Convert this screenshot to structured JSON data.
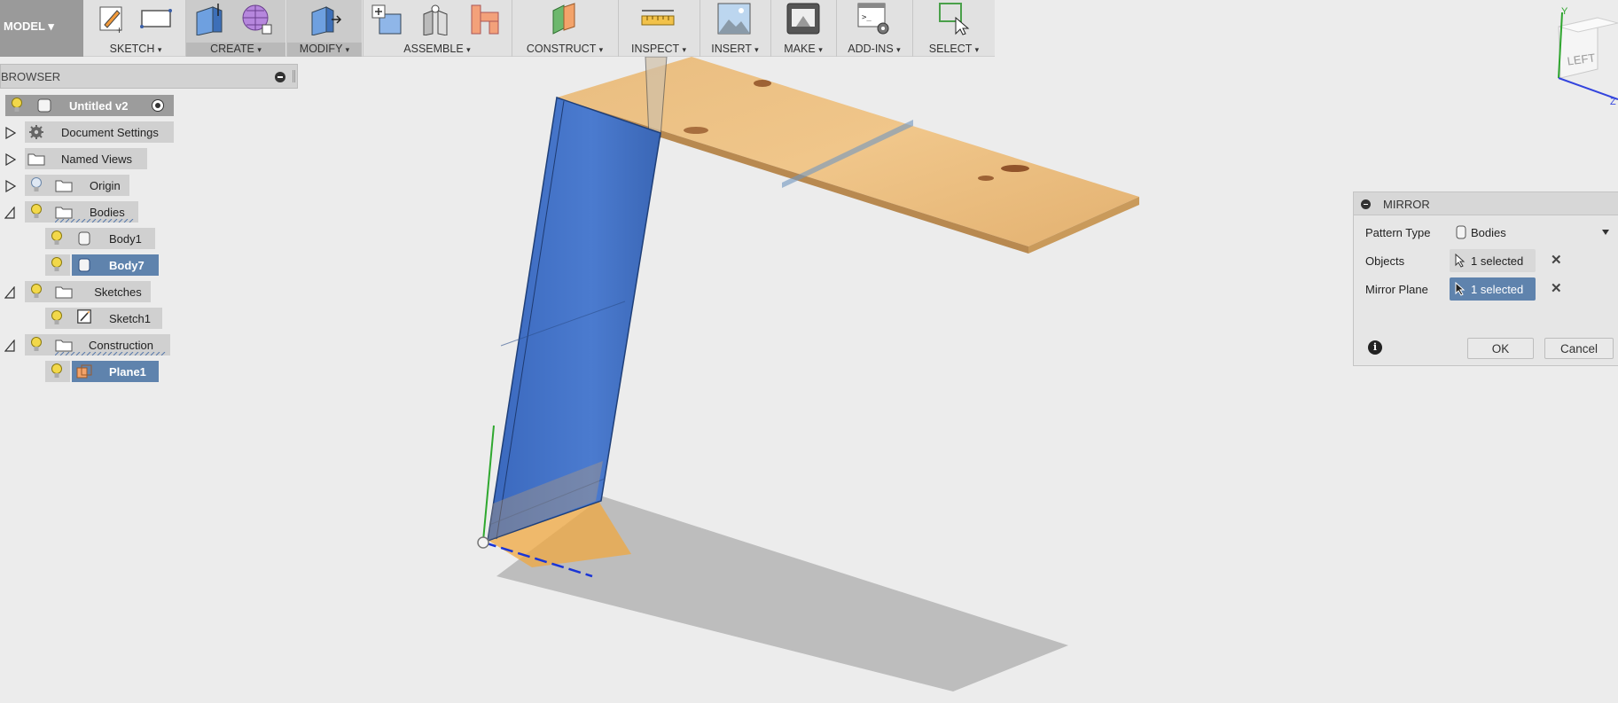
{
  "toolbar": {
    "model_label": "MODEL",
    "groups": {
      "sketch": "SKETCH",
      "create": "CREATE",
      "modify": "MODIFY",
      "assemble": "ASSEMBLE",
      "construct": "CONSTRUCT",
      "inspect": "INSPECT",
      "insert": "INSERT",
      "make": "MAKE",
      "addins": "ADD-INS",
      "select": "SELECT"
    },
    "caret": "▾"
  },
  "browser": {
    "title": "BROWSER",
    "document": "Untitled v2",
    "items": {
      "document_settings": "Document Settings",
      "named_views": "Named Views",
      "origin": "Origin",
      "bodies": "Bodies",
      "body1": "Body1",
      "body7": "Body7",
      "sketches": "Sketches",
      "sketch1": "Sketch1",
      "construction": "Construction",
      "plane1": "Plane1"
    }
  },
  "viewcube": {
    "face_label": "LEFT",
    "axis_y": "Y",
    "axis_z": "Z"
  },
  "dialog": {
    "title": "MIRROR",
    "pattern_type_label": "Pattern Type",
    "pattern_type_value": "Bodies",
    "objects_label": "Objects",
    "objects_value": "1 selected",
    "mirror_plane_label": "Mirror Plane",
    "mirror_plane_value": "1 selected",
    "ok_label": "OK",
    "cancel_label": "Cancel",
    "close_symbol": "✕",
    "info_symbol": "i"
  },
  "colors": {
    "selection_blue": "#5f83ad",
    "body_blue": "#3f6fc4",
    "wood": "#e7b672",
    "plane_orange": "#f0a840"
  }
}
